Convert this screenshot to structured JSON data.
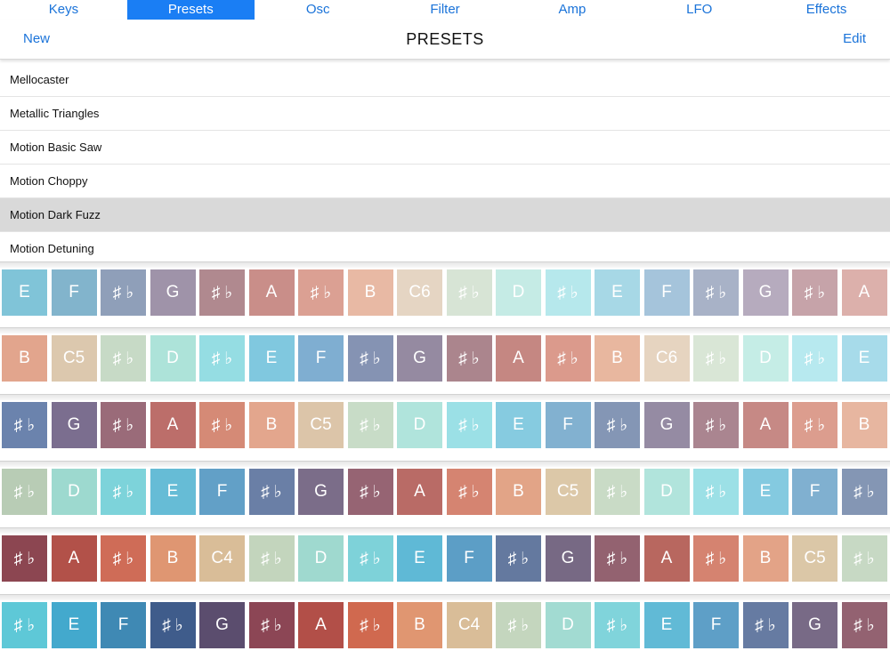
{
  "tabs": [
    {
      "label": "Keys",
      "active": false
    },
    {
      "label": "Presets",
      "active": true
    },
    {
      "label": "Osc",
      "active": false
    },
    {
      "label": "Filter",
      "active": false
    },
    {
      "label": "Amp",
      "active": false
    },
    {
      "label": "LFO",
      "active": false
    },
    {
      "label": "Effects",
      "active": false
    }
  ],
  "nav": {
    "new_label": "New",
    "title": "PRESETS",
    "edit_label": "Edit"
  },
  "presets": [
    {
      "name": "Mellocaster",
      "selected": false
    },
    {
      "name": "Metallic Triangles",
      "selected": false
    },
    {
      "name": "Motion Basic Saw",
      "selected": false
    },
    {
      "name": "Motion Choppy",
      "selected": false
    },
    {
      "name": "Motion Dark Fuzz",
      "selected": true
    },
    {
      "name": "Motion Detuning",
      "selected": false
    }
  ],
  "keyboard": {
    "rows": [
      {
        "keys": [
          {
            "label": "E",
            "color": "#80c4d8"
          },
          {
            "label": "F",
            "color": "#82b4cc"
          },
          {
            "label": "♯ ♭",
            "color": "#8f9fb9"
          },
          {
            "label": "G",
            "color": "#9f93a9"
          },
          {
            "label": "♯ ♭",
            "color": "#b0898f"
          },
          {
            "label": "A",
            "color": "#c98e89"
          },
          {
            "label": "♯ ♭",
            "color": "#dba093"
          },
          {
            "label": "B",
            "color": "#e8b9a4"
          },
          {
            "label": "C6",
            "color": "#e5d5c3"
          },
          {
            "label": "♯ ♭",
            "color": "#d7e4d5"
          },
          {
            "label": "D",
            "color": "#c5ebe5"
          },
          {
            "label": "♯ ♭",
            "color": "#b6e8ec"
          },
          {
            "label": "E",
            "color": "#a7d8e6"
          },
          {
            "label": "F",
            "color": "#a5c4db"
          },
          {
            "label": "♯ ♭",
            "color": "#a8b2c7"
          },
          {
            "label": "G",
            "color": "#b6abbe"
          },
          {
            "label": "♯ ♭",
            "color": "#c6a3a9"
          },
          {
            "label": "A",
            "color": "#dcb0ab"
          }
        ]
      },
      {
        "keys": [
          {
            "label": "B",
            "color": "#e2a58d"
          },
          {
            "label": "C5",
            "color": "#dcc8ae"
          },
          {
            "label": "♯ ♭",
            "color": "#c7dac6"
          },
          {
            "label": "D",
            "color": "#ade3d9"
          },
          {
            "label": "♯ ♭",
            "color": "#95dde3"
          },
          {
            "label": "E",
            "color": "#80c8df"
          },
          {
            "label": "F",
            "color": "#7faed1"
          },
          {
            "label": "♯ ♭",
            "color": "#8593b3"
          },
          {
            "label": "G",
            "color": "#958aa1"
          },
          {
            "label": "♯ ♭",
            "color": "#ab858d"
          },
          {
            "label": "A",
            "color": "#c58782"
          },
          {
            "label": "♯ ♭",
            "color": "#db9a8c"
          },
          {
            "label": "B",
            "color": "#e8b79f"
          },
          {
            "label": "C6",
            "color": "#e6d4c0"
          },
          {
            "label": "♯ ♭",
            "color": "#d9e6d6"
          },
          {
            "label": "D",
            "color": "#c5ede6"
          },
          {
            "label": "♯ ♭",
            "color": "#b7e9ef"
          },
          {
            "label": "E",
            "color": "#a7dbea"
          }
        ]
      },
      {
        "keys": [
          {
            "label": "♯ ♭",
            "color": "#6b83ad"
          },
          {
            "label": "G",
            "color": "#7b6e8f"
          },
          {
            "label": "♯ ♭",
            "color": "#9a6b79"
          },
          {
            "label": "A",
            "color": "#bc6e6a"
          },
          {
            "label": "♯ ♭",
            "color": "#d58a76"
          },
          {
            "label": "B",
            "color": "#e3a68d"
          },
          {
            "label": "C5",
            "color": "#dcc5a9"
          },
          {
            "label": "♯ ♭",
            "color": "#c8dcc7"
          },
          {
            "label": "D",
            "color": "#b0e4dc"
          },
          {
            "label": "♯ ♭",
            "color": "#9be0e6"
          },
          {
            "label": "E",
            "color": "#86cbe0"
          },
          {
            "label": "F",
            "color": "#82b1d0"
          },
          {
            "label": "♯ ♭",
            "color": "#8496b5"
          },
          {
            "label": "G",
            "color": "#958ba3"
          },
          {
            "label": "♯ ♭",
            "color": "#aa8590"
          },
          {
            "label": "A",
            "color": "#c68985"
          },
          {
            "label": "♯ ♭",
            "color": "#dc9d8e"
          },
          {
            "label": "B",
            "color": "#e7b6a0"
          }
        ]
      },
      {
        "keys": [
          {
            "label": "♯ ♭",
            "color": "#b8ccb5"
          },
          {
            "label": "D",
            "color": "#9dd9cf"
          },
          {
            "label": "♯ ♭",
            "color": "#7dd3da"
          },
          {
            "label": "E",
            "color": "#66bcd6"
          },
          {
            "label": "F",
            "color": "#62a0c7"
          },
          {
            "label": "♯ ♭",
            "color": "#6a7fa6"
          },
          {
            "label": "G",
            "color": "#7b6d89"
          },
          {
            "label": "♯ ♭",
            "color": "#966473"
          },
          {
            "label": "A",
            "color": "#b96b66"
          },
          {
            "label": "♯ ♭",
            "color": "#d58471"
          },
          {
            "label": "B",
            "color": "#e2a487"
          },
          {
            "label": "C5",
            "color": "#dcc8a8"
          },
          {
            "label": "♯ ♭",
            "color": "#c9dbc6"
          },
          {
            "label": "D",
            "color": "#b1e4dc"
          },
          {
            "label": "♯ ♭",
            "color": "#9ce0e6"
          },
          {
            "label": "E",
            "color": "#84cae0"
          },
          {
            "label": "F",
            "color": "#80b0d0"
          },
          {
            "label": "♯ ♭",
            "color": "#8496b4"
          }
        ]
      },
      {
        "keys": [
          {
            "label": "♯ ♭",
            "color": "#8c4651"
          },
          {
            "label": "A",
            "color": "#b25149"
          },
          {
            "label": "♯ ♭",
            "color": "#cf6c57"
          },
          {
            "label": "B",
            "color": "#df9672"
          },
          {
            "label": "C4",
            "color": "#d9bd98"
          },
          {
            "label": "♯ ♭",
            "color": "#c3d5bd"
          },
          {
            "label": "D",
            "color": "#9fd9cf"
          },
          {
            "label": "♯ ♭",
            "color": "#7ed2d9"
          },
          {
            "label": "E",
            "color": "#5fb9d6"
          },
          {
            "label": "F",
            "color": "#5c9ec6"
          },
          {
            "label": "♯ ♭",
            "color": "#64799f"
          },
          {
            "label": "G",
            "color": "#776984"
          },
          {
            "label": "♯ ♭",
            "color": "#936270"
          },
          {
            "label": "A",
            "color": "#b8675f"
          },
          {
            "label": "♯ ♭",
            "color": "#d58370"
          },
          {
            "label": "B",
            "color": "#e3a387"
          },
          {
            "label": "C5",
            "color": "#dbc7a7"
          },
          {
            "label": "♯ ♭",
            "color": "#c7d9c4"
          }
        ]
      },
      {
        "keys": [
          {
            "label": "♯ ♭",
            "color": "#5ec8d7"
          },
          {
            "label": "E",
            "color": "#43a9cd"
          },
          {
            "label": "F",
            "color": "#3f89b4"
          },
          {
            "label": "♯ ♭",
            "color": "#3f5c8b"
          },
          {
            "label": "G",
            "color": "#5b4d6e"
          },
          {
            "label": "♯ ♭",
            "color": "#8c4655"
          },
          {
            "label": "A",
            "color": "#b24f48"
          },
          {
            "label": "♯ ♭",
            "color": "#d0694f"
          },
          {
            "label": "B",
            "color": "#e09671"
          },
          {
            "label": "C4",
            "color": "#d9bd98"
          },
          {
            "label": "♯ ♭",
            "color": "#c4d6be"
          },
          {
            "label": "D",
            "color": "#a2dbd2"
          },
          {
            "label": "♯ ♭",
            "color": "#80d4db"
          },
          {
            "label": "E",
            "color": "#61bad6"
          },
          {
            "label": "F",
            "color": "#5e9fc7"
          },
          {
            "label": "♯ ♭",
            "color": "#667ba2"
          },
          {
            "label": "G",
            "color": "#786a86"
          },
          {
            "label": "♯ ♭",
            "color": "#936271"
          }
        ]
      }
    ]
  }
}
